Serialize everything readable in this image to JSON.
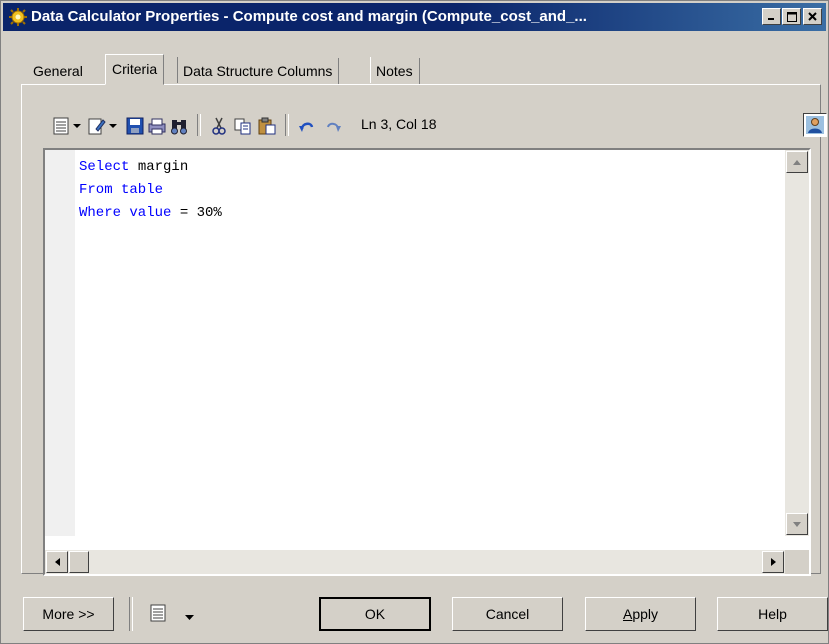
{
  "window": {
    "title": "Data Calculator Properties - Compute cost and margin (Compute_cost_and_...",
    "controls": [
      "minimize-icon",
      "maximize-icon",
      "close-icon"
    ]
  },
  "tabs": [
    {
      "label": "General",
      "active": false
    },
    {
      "label": "Criteria",
      "active": true
    },
    {
      "label": "Data Structure Columns",
      "active": false
    },
    {
      "label": "Notes",
      "active": false
    }
  ],
  "toolbar": {
    "icons": [
      "properties-icon",
      "dropdown-arrow-icon",
      "edit-icon",
      "dropdown-arrow-icon",
      "save-icon",
      "print-icon",
      "find-icon",
      "cut-icon",
      "copy-icon",
      "paste-icon",
      "undo-icon",
      "redo-icon"
    ],
    "cursor_position": "Ln 3, Col 18",
    "user_icon": "user-icon"
  },
  "editor": {
    "lines": [
      {
        "keyword": "Select",
        "rest": " margin"
      },
      {
        "keyword": "From table",
        "rest": ""
      },
      {
        "keyword": "Where value",
        "rest": " = 30%"
      }
    ],
    "keyword_color": "#0000ff"
  },
  "buttons": {
    "more": "More >>",
    "ok": "OK",
    "cancel": "Cancel",
    "apply_prefix": "A",
    "apply_rest": "pply",
    "help": "Help"
  }
}
